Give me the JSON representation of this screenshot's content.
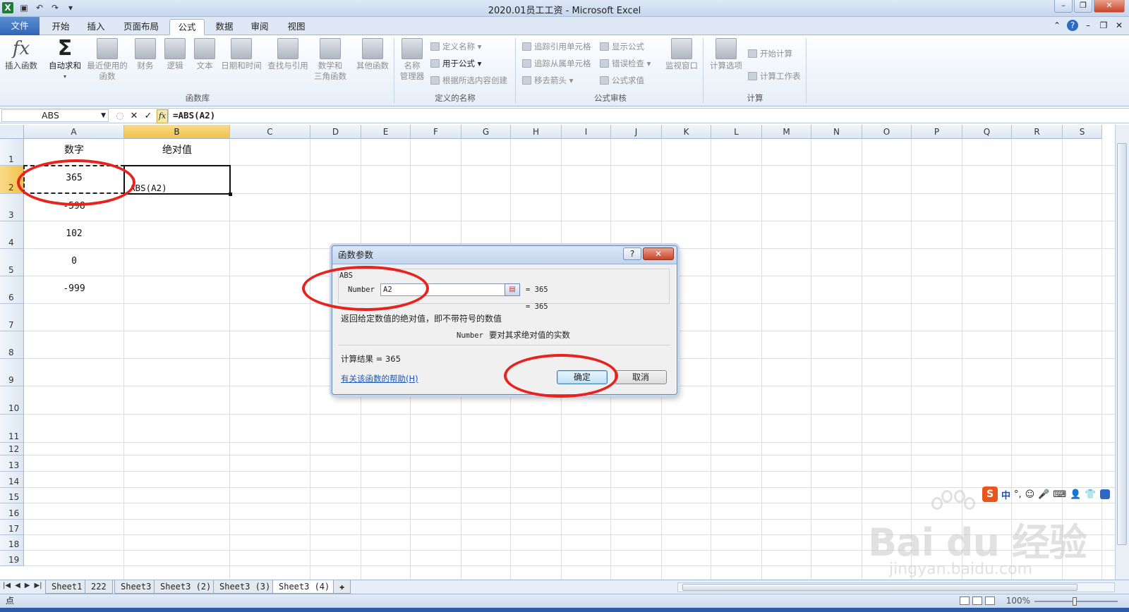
{
  "window": {
    "title": "2020.01员工工资 - Microsoft Excel"
  },
  "ribbon_tabs": [
    "文件",
    "开始",
    "插入",
    "页面布局",
    "公式",
    "数据",
    "审阅",
    "视图"
  ],
  "ribbon": {
    "insert_function": "插入函数",
    "autosum": "自动求和",
    "recent_1": "最近使用的",
    "recent_2": "函数",
    "financial": "财务",
    "logical": "逻辑",
    "text": "文本",
    "datetime": "日期和时间",
    "lookup": "查找与引用",
    "math_1": "数学和",
    "math_2": "三角函数",
    "more": "其他函数",
    "group_library": "函数库",
    "name_mgr_1": "名称",
    "name_mgr_2": "管理器",
    "define_name": "定义名称",
    "use_in_formula": "用于公式",
    "create_from_sel": "根据所选内容创建",
    "group_names": "定义的名称",
    "trace_precedents": "追踪引用单元格",
    "trace_dependents": "追踪从属单元格",
    "remove_arrows": "移去箭头",
    "show_formulas": "显示公式",
    "error_check": "错误检查",
    "evaluate": "公式求值",
    "watch": "监视窗口",
    "group_audit": "公式审核",
    "calc_options": "计算选项",
    "calc_now": "开始计算",
    "calc_sheet": "计算工作表",
    "group_calc": "计算"
  },
  "formula_bar": {
    "name_box": "ABS",
    "formula": "=ABS(A2)"
  },
  "columns": [
    "A",
    "B",
    "C",
    "D",
    "E",
    "F",
    "G",
    "H",
    "I",
    "J",
    "K",
    "L",
    "M",
    "N",
    "O",
    "P",
    "Q",
    "R",
    "S"
  ],
  "rows": [
    "1",
    "2",
    "3",
    "4",
    "5",
    "6",
    "7",
    "8",
    "9",
    "10",
    "11",
    "12",
    "13",
    "14",
    "15",
    "16",
    "17",
    "18",
    "19"
  ],
  "cells": {
    "A1": "数字",
    "B1": "绝对值",
    "A2": "365",
    "B2": "ABS(A2)",
    "A3": "-598",
    "A4": "102",
    "A5": "0",
    "A6": "-999"
  },
  "dialog": {
    "title": "函数参数",
    "help": "?",
    "function_name": "ABS",
    "param_label": "Number",
    "param_value": "A2",
    "param_result": "=  365",
    "func_result": "=  365",
    "description": "返回给定数值的绝对值，即不带符号的数值",
    "param_name": "Number",
    "param_desc": "要对其求绝对值的实数",
    "calc_result": "计算结果 =  365",
    "help_link": "有关该函数的帮助(H)",
    "ok": "确定",
    "cancel": "取消"
  },
  "sheets": [
    "Sheet1",
    "222",
    "Sheet3",
    "Sheet3 (2)",
    "Sheet3 (3)",
    "Sheet3 (4)"
  ],
  "status": {
    "mode": "点",
    "zoom": "100%"
  },
  "ime": {
    "mode": "中"
  },
  "watermark": {
    "main": "Bai du 经验",
    "sub": "jingyan.baidu.com"
  }
}
